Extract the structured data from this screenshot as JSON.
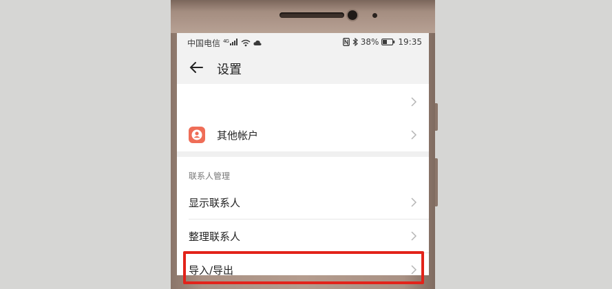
{
  "status_bar": {
    "carrier": "中国电信",
    "signal_label": "4G",
    "battery_percent": "38%",
    "time": "19:35"
  },
  "app_bar": {
    "title": "设置"
  },
  "rows": {
    "other_accounts": "其他帐户",
    "section_header": "联系人管理",
    "show_contacts": "显示联系人",
    "organize_contacts": "整理联系人",
    "import_export": "导入/导出"
  },
  "colors": {
    "highlight": "#e2231a",
    "account_icon": "#ef6d57"
  }
}
